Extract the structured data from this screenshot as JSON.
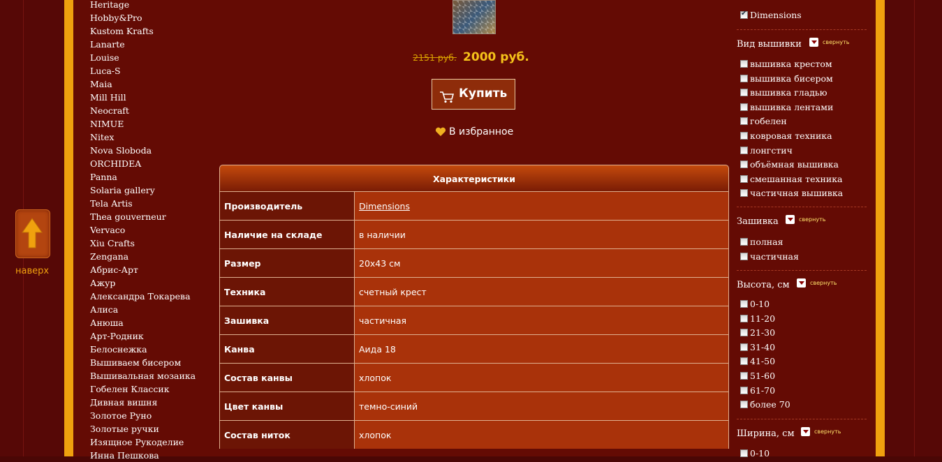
{
  "back_to_top": {
    "label": "наверх"
  },
  "brands": [
    "Heritage",
    "Hobby&Pro",
    "Kustom Krafts",
    "Lanarte",
    "Louise",
    "Luca-S",
    "Maia",
    "Mill Hill",
    "Neocraft",
    "NIMUE",
    "Nitex",
    "Nova Sloboda",
    "ORCHIDEA",
    "Panna",
    "Solaria gallery",
    "Tela Artis",
    "Thea gouverneur",
    "Vervaco",
    "Xiu Crafts",
    "Zengana",
    "Абрис-Арт",
    "Ажур",
    "Александра Токарева",
    "Алиса",
    "Анюша",
    "Арт-Родник",
    "Белоснежка",
    "Вышиваем бисером",
    "Вышивальная мозаика",
    "Гобелен Классик",
    "Дивная вишня",
    "Золотое Руно",
    "Золотые ручки",
    "Изящное Рукоделие",
    "Инна Пешкова"
  ],
  "product": {
    "old_price": "2151 руб.",
    "new_price": "2000 руб.",
    "buy_label": "Купить",
    "favorite_label": "В избранное"
  },
  "specs": {
    "title": "Характеристики",
    "rows": [
      {
        "key": "Производитель",
        "value": "Dimensions"
      },
      {
        "key": "Наличие на складе",
        "value": "в наличии"
      },
      {
        "key": "Размер",
        "value": "20x43 см"
      },
      {
        "key": "Техника",
        "value": "счетный крест"
      },
      {
        "key": "Зашивка",
        "value": "частичная"
      },
      {
        "key": "Канва",
        "value": "Аида 18"
      },
      {
        "key": "Состав канвы",
        "value": "хлопок"
      },
      {
        "key": "Цвет канвы",
        "value": "темно-синий"
      },
      {
        "key": "Состав ниток",
        "value": "хлопок"
      }
    ]
  },
  "filters": {
    "collapse_label": "свернуть",
    "manufacturer": {
      "selected": "Dimensions"
    },
    "embroidery_type": {
      "title": "Вид вышивки",
      "options": [
        "вышивка крестом",
        "вышивка бисером",
        "вышивка гладью",
        "вышивка лентами",
        "гобелен",
        "ковровая техника",
        "лонгстич",
        "объёмная вышивка",
        "смешанная техника",
        "частичная вышивка"
      ]
    },
    "fill": {
      "title": "Зашивка",
      "options": [
        "полная",
        "частичная"
      ]
    },
    "height": {
      "title": "Высота, см",
      "options": [
        "0-10",
        "11-20",
        "21-30",
        "31-40",
        "41-50",
        "51-60",
        "61-70",
        "более 70"
      ]
    },
    "width": {
      "title": "Ширина, см",
      "options": [
        "0-10"
      ]
    }
  }
}
